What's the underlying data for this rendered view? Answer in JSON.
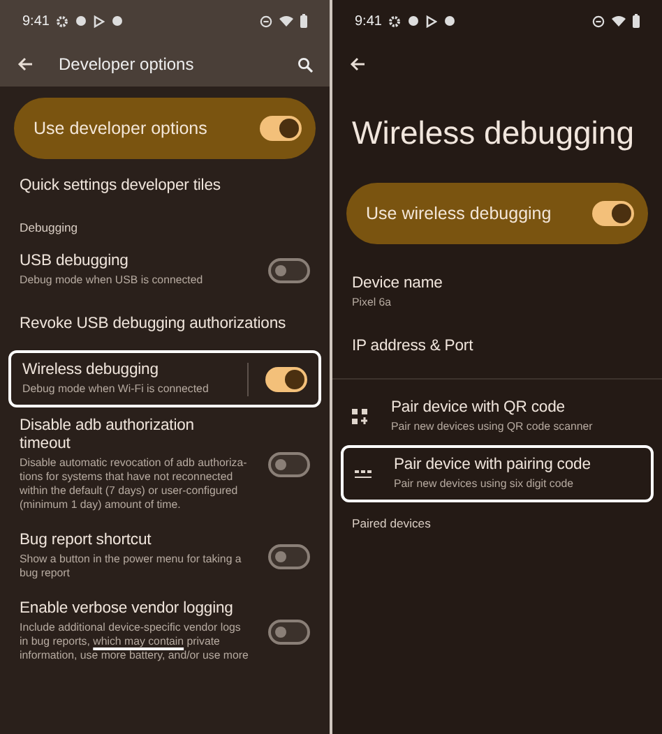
{
  "left": {
    "status_bar": {
      "time": "9:41"
    },
    "app_bar": {
      "title": "Developer options"
    },
    "main_switch": {
      "label": "Use developer options",
      "on": true
    },
    "items": [
      {
        "kind": "link",
        "title": "Quick settings developer tiles"
      },
      {
        "kind": "header",
        "title": "Debugging"
      },
      {
        "kind": "switch",
        "title": "USB debugging",
        "summary": [
          {
            "text": "Debug mode when USB is connected",
            "underlined": false
          }
        ],
        "on": false,
        "highlighted": false
      },
      {
        "kind": "link",
        "title": "Revoke USB debugging authorizations"
      },
      {
        "kind": "split-switch",
        "title": "Wireless debugging",
        "summary": [
          {
            "text": "Debug mode when Wi-Fi is connected",
            "underlined": false
          }
        ],
        "on": true,
        "highlighted": true
      },
      {
        "kind": "switch",
        "title": "Disable adb authorization timeout",
        "summary": [
          {
            "text": "Disable automatic revocation of adb authoriza-tions for systems that have not reconnected within the default (7 days) or user-configured (minimum 1 day) amount of time.",
            "underlined": false
          }
        ],
        "on": false,
        "highlighted": false
      },
      {
        "kind": "switch",
        "title": "Bug report shortcut",
        "summary": [
          {
            "text": "Show a button in the power menu for taking a bug report",
            "underlined": false
          }
        ],
        "on": false,
        "highlighted": false
      },
      {
        "kind": "switch",
        "title": "Enable verbose vendor logging",
        "summary": [
          {
            "text": "Include additional device-specific vendor logs in bug reports, ",
            "underlined": false
          },
          {
            "text": "which may contain",
            "underlined": true
          },
          {
            "text": " private information, use more battery, and/or use more",
            "underlined": false
          }
        ],
        "on": false,
        "highlighted": false
      }
    ]
  },
  "right": {
    "status_bar": {
      "time": "9:41"
    },
    "title": "Wireless debugging",
    "main_switch": {
      "label": "Use wireless debugging",
      "on": true
    },
    "items": [
      {
        "kind": "info",
        "title": "Device name",
        "summary": "Pixel 6a",
        "highlighted": false
      },
      {
        "kind": "info",
        "title": "IP address & Port",
        "highlighted": false
      },
      {
        "kind": "qr",
        "title": "Pair device with QR code",
        "summary": "Pair new devices using QR code scanner",
        "highlighted": false
      },
      {
        "kind": "code",
        "title": "Pair device with pairing code",
        "summary": "Pair new devices using six digit code",
        "highlighted": true
      },
      {
        "kind": "header",
        "title": "Paired devices"
      }
    ]
  }
}
